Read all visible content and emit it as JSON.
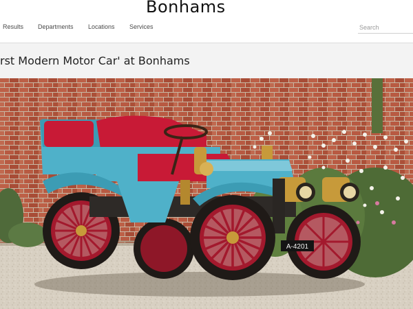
{
  "brand": {
    "logo_text": "Bonhams"
  },
  "nav": {
    "items": [
      {
        "label": "Results"
      },
      {
        "label": "Departments"
      },
      {
        "label": "Locations"
      },
      {
        "label": "Services"
      }
    ]
  },
  "search": {
    "placeholder": "Search",
    "value": ""
  },
  "page": {
    "title": "rst Modern Motor Car' at Bonhams"
  },
  "photo": {
    "plate_text": "A-4201",
    "colors": {
      "brick": "#b3553d",
      "body": "#4fb1c9",
      "upholstery": "#c81a36",
      "wheel": "#a3192d",
      "brass": "#c79a3a",
      "gravel": "#d8d0c2"
    }
  }
}
